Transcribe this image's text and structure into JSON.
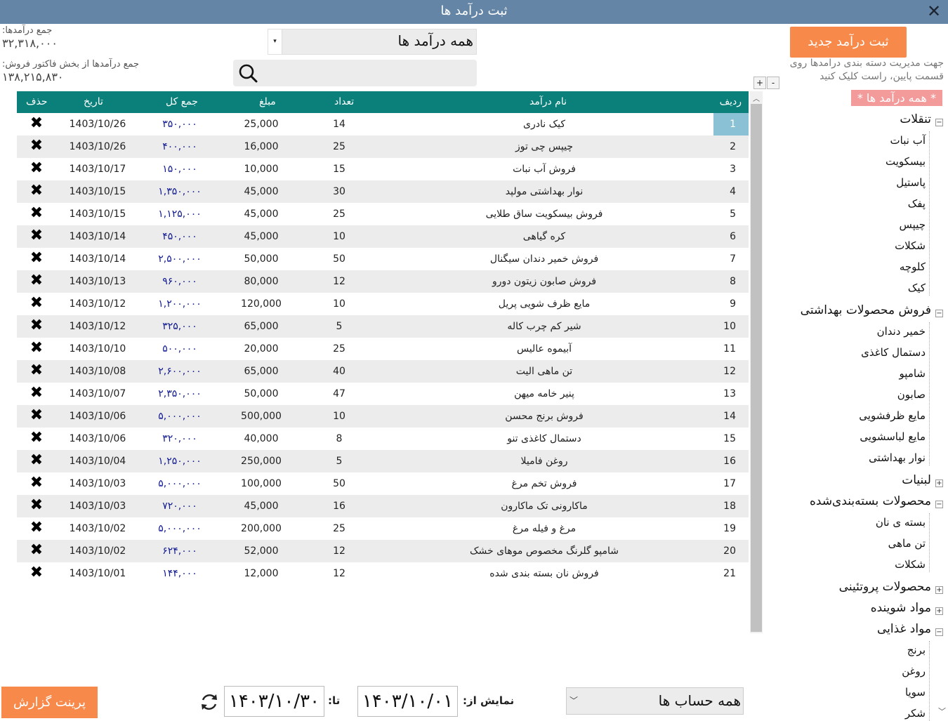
{
  "window": {
    "title": "ثبت درآمد ها",
    "close_symbol": "✕"
  },
  "stats": {
    "total_label": "جمع درآمدها:",
    "total_value": "۳۲,۳۱۸,۰۰۰",
    "invoice_label": "جمع درآمدها از بخش فاکتور فروش:",
    "invoice_value": "۱۳۸,۲۱۵,۸۳۰"
  },
  "filter": {
    "selected": "همه درآمد ها",
    "arrow": "▾"
  },
  "search": {
    "placeholder": "",
    "value": ""
  },
  "toolbar": {
    "new_label": "ثبت درآمد جدید",
    "hint": "جهت مدیریت دسته بندی درامدها روی قسمت پایین، راست کلیک کنید"
  },
  "tree_controls": {
    "expand": "+",
    "collapse": "-"
  },
  "grid": {
    "columns": {
      "idx": "ردیف",
      "name": "نام درآمد",
      "count": "تعداد",
      "price": "مبلغ",
      "total": "جمع کل",
      "date": "تاریخ",
      "delete": "حذف"
    },
    "delete_symbol": "✖",
    "rows": [
      {
        "idx": "1",
        "name": "کیک نادری",
        "count": "14",
        "price": "25,000",
        "total": "۳۵۰,۰۰۰",
        "date": "1403/10/26"
      },
      {
        "idx": "2",
        "name": "چیپس چی توز",
        "count": "25",
        "price": "16,000",
        "total": "۴۰۰,۰۰۰",
        "date": "1403/10/26"
      },
      {
        "idx": "3",
        "name": "فروش آب نبات",
        "count": "15",
        "price": "10,000",
        "total": "۱۵۰,۰۰۰",
        "date": "1403/10/17"
      },
      {
        "idx": "4",
        "name": "نوار بهداشتی مولپد",
        "count": "30",
        "price": "45,000",
        "total": "۱,۳۵۰,۰۰۰",
        "date": "1403/10/15"
      },
      {
        "idx": "5",
        "name": "فروش بیسکویت ساق طلایی",
        "count": "25",
        "price": "45,000",
        "total": "۱,۱۲۵,۰۰۰",
        "date": "1403/10/15"
      },
      {
        "idx": "6",
        "name": "کره گیاهی",
        "count": "10",
        "price": "45,000",
        "total": "۴۵۰,۰۰۰",
        "date": "1403/10/14"
      },
      {
        "idx": "7",
        "name": "فروش خمیر دندان سیگنال",
        "count": "50",
        "price": "50,000",
        "total": "۲,۵۰۰,۰۰۰",
        "date": "1403/10/14"
      },
      {
        "idx": "8",
        "name": "فروش صابون زیتون دورو",
        "count": "12",
        "price": "80,000",
        "total": "۹۶۰,۰۰۰",
        "date": "1403/10/13"
      },
      {
        "idx": "9",
        "name": "مایع ظرف شویی پریل",
        "count": "10",
        "price": "120,000",
        "total": "۱,۲۰۰,۰۰۰",
        "date": "1403/10/12"
      },
      {
        "idx": "10",
        "name": "شیر کم چرب کاله",
        "count": "5",
        "price": "65,000",
        "total": "۳۲۵,۰۰۰",
        "date": "1403/10/12"
      },
      {
        "idx": "11",
        "name": "آبیموه عالیس",
        "count": "25",
        "price": "20,000",
        "total": "۵۰۰,۰۰۰",
        "date": "1403/10/10"
      },
      {
        "idx": "12",
        "name": "تن ماهی الیت",
        "count": "40",
        "price": "65,000",
        "total": "۲,۶۰۰,۰۰۰",
        "date": "1403/10/08"
      },
      {
        "idx": "13",
        "name": "پنیر خامه میهن",
        "count": "47",
        "price": "50,000",
        "total": "۲,۳۵۰,۰۰۰",
        "date": "1403/10/07"
      },
      {
        "idx": "14",
        "name": "فروش برنج محسن",
        "count": "10",
        "price": "500,000",
        "total": "۵,۰۰۰,۰۰۰",
        "date": "1403/10/06"
      },
      {
        "idx": "15",
        "name": "دستمال کاغذی تنو",
        "count": "8",
        "price": "40,000",
        "total": "۳۲۰,۰۰۰",
        "date": "1403/10/06"
      },
      {
        "idx": "16",
        "name": "روغن فامیلا",
        "count": "5",
        "price": "250,000",
        "total": "۱,۲۵۰,۰۰۰",
        "date": "1403/10/04"
      },
      {
        "idx": "17",
        "name": "فروش تخم مرغ",
        "count": "50",
        "price": "100,000",
        "total": "۵,۰۰۰,۰۰۰",
        "date": "1403/10/03"
      },
      {
        "idx": "18",
        "name": "ماکارونی تک ماکارون",
        "count": "16",
        "price": "45,000",
        "total": "۷۲۰,۰۰۰",
        "date": "1403/10/03"
      },
      {
        "idx": "19",
        "name": "مرغ و فیله مرغ",
        "count": "25",
        "price": "200,000",
        "total": "۵,۰۰۰,۰۰۰",
        "date": "1403/10/02"
      },
      {
        "idx": "20",
        "name": "شامپو گلرنگ مخصوص موهای خشک",
        "count": "12",
        "price": "52,000",
        "total": "۶۲۴,۰۰۰",
        "date": "1403/10/02"
      },
      {
        "idx": "21",
        "name": "فروش نان بسته بندی شده",
        "count": "12",
        "price": "12,000",
        "total": "۱۴۴,۰۰۰",
        "date": "1403/10/01"
      }
    ]
  },
  "tree": {
    "all_label": "* همه درآمد ها *",
    "groups": [
      {
        "label": "تنقلات",
        "expanded": true,
        "items": [
          "آب نبات",
          "بیسکویت",
          "پاستیل",
          "پفک",
          "چیپس",
          "شکلات",
          "کلوچه",
          "کیک"
        ]
      },
      {
        "label": "فروش محصولات بهداشتی",
        "expanded": true,
        "items": [
          "خمیر دندان",
          "دستمال کاغذی",
          "شامپو",
          "صابون",
          "مایع ظرفشویی",
          "مایع لباسشویی",
          "نوار بهداشتی"
        ]
      },
      {
        "label": "لبنیات",
        "expanded": false,
        "items": []
      },
      {
        "label": "محصولات بسته‌بندی‌شده",
        "expanded": true,
        "items": [
          "بسته ی نان",
          "تن ماهی",
          "شکلات"
        ]
      },
      {
        "label": "محصولات پروتئینی",
        "expanded": false,
        "items": []
      },
      {
        "label": "مواد شوینده",
        "expanded": false,
        "items": []
      },
      {
        "label": "مواد غذایی",
        "expanded": true,
        "items": [
          "برنج",
          "روغن",
          "سویا",
          "شکر"
        ]
      }
    ]
  },
  "footer": {
    "print_label": "پرینت گزارش",
    "to_label": "تا:",
    "to_date": "۱۴۰۳/۱۰/۳۰",
    "from_label": "نمایش از:",
    "from_date": "۱۴۰۳/۱۰/۰۱",
    "account_selected": "همه حساب ها",
    "account_arrow": "﹀"
  }
}
